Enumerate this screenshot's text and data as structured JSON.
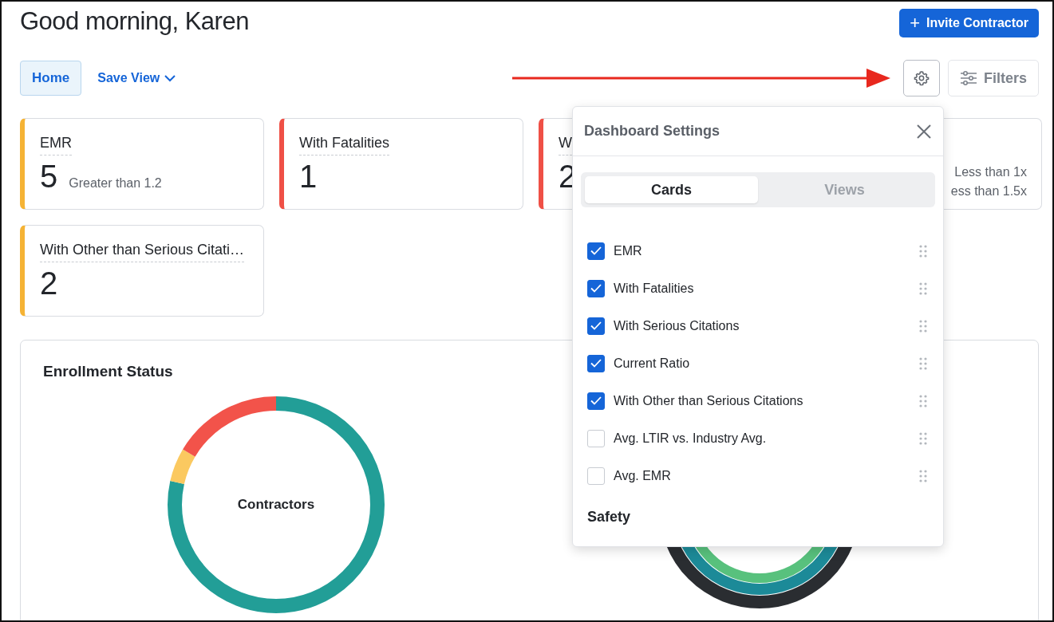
{
  "greeting": "Good morning, Karen",
  "invite_button": {
    "icon": "+",
    "label": "Invite Contractor"
  },
  "view_tabs": [
    {
      "label": "Home",
      "selected": true
    }
  ],
  "save_view": {
    "label": "Save View"
  },
  "filters_button": {
    "label": "Filters"
  },
  "cards": [
    {
      "title": "EMR",
      "value": "5",
      "note": "Greater than 1.2",
      "color": "#f5b335"
    },
    {
      "title": "With Fatalities",
      "value": "1",
      "color": "#ef5046"
    },
    {
      "title": "W",
      "value": "2",
      "color": "#ef5046"
    },
    {
      "notes": [
        "Less than 1x",
        "ess than 1.5x"
      ],
      "color": "#e2e4e8"
    },
    {
      "title": "With Other than Serious Citati…",
      "value": "2",
      "color": "#f5b335"
    }
  ],
  "enrollment_panel": {
    "title": "Enrollment Status",
    "center_label": "Contractors"
  },
  "settings_popover": {
    "title": "Dashboard Settings",
    "tabs": [
      {
        "label": "Cards",
        "selected": true
      },
      {
        "label": "Views",
        "selected": false
      }
    ],
    "items": [
      {
        "label": "EMR",
        "checked": true
      },
      {
        "label": "With Fatalities",
        "checked": true
      },
      {
        "label": "With Serious Citations",
        "checked": true
      },
      {
        "label": "Current Ratio",
        "checked": true
      },
      {
        "label": "With Other than Serious Citations",
        "checked": true
      },
      {
        "label": "Avg. LTIR vs. Industry Avg.",
        "checked": false
      },
      {
        "label": "Avg. EMR",
        "checked": false
      }
    ],
    "section": "Safety"
  }
}
